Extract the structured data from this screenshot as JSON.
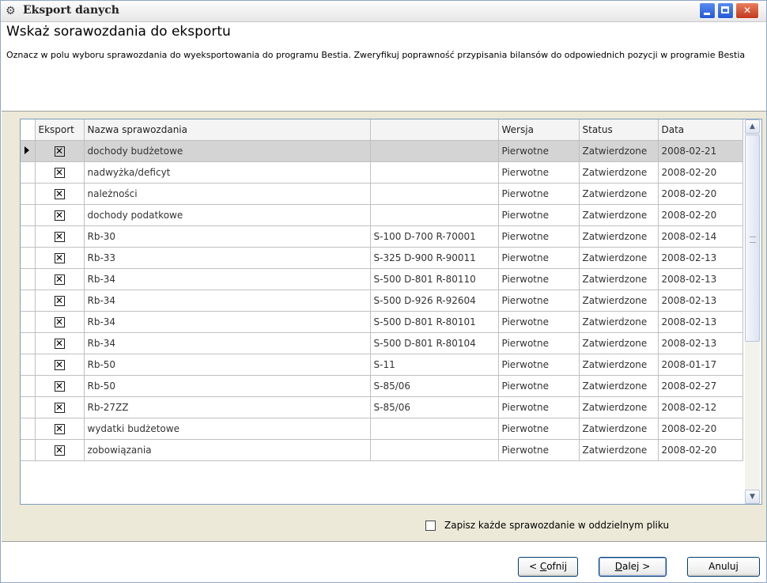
{
  "window": {
    "title": "Eksport danych",
    "icon": "export-icon",
    "controls": {
      "minimize": "minimize-icon",
      "maximize": "maximize-icon",
      "close": "close-icon"
    }
  },
  "header": {
    "heading": "Wskaż sorawozdania do eksportu",
    "description": "Oznacz w polu wyboru sprawozdania do wyeksportowania do programu Bestia. Zweryfikuj poprawność przypisania bilansów do odpowiednich pozycji w programie Bestia"
  },
  "grid": {
    "columns": [
      "Eksport",
      "Nazwa sprawozdania",
      "",
      "Wersja",
      "Status",
      "Data"
    ],
    "rows": [
      {
        "checked": "✕",
        "name": "dochody budżetowe",
        "code": "",
        "version": "Pierwotne",
        "status": "Zatwierdzone",
        "date": "2008-02-21"
      },
      {
        "checked": "✕",
        "name": "nadwyżka/deficyt",
        "code": "",
        "version": "Pierwotne",
        "status": "Zatwierdzone",
        "date": "2008-02-20"
      },
      {
        "checked": "✕",
        "name": "należności",
        "code": "",
        "version": "Pierwotne",
        "status": "Zatwierdzone",
        "date": "2008-02-20"
      },
      {
        "checked": "✕",
        "name": "dochody podatkowe",
        "code": "",
        "version": "Pierwotne",
        "status": "Zatwierdzone",
        "date": "2008-02-20"
      },
      {
        "checked": "✕",
        "name": "Rb-30",
        "code": "S-100 D-700 R-70001",
        "version": "Pierwotne",
        "status": "Zatwierdzone",
        "date": "2008-02-14"
      },
      {
        "checked": "✕",
        "name": "Rb-33",
        "code": "S-325 D-900 R-90011",
        "version": "Pierwotne",
        "status": "Zatwierdzone",
        "date": "2008-02-13"
      },
      {
        "checked": "✕",
        "name": "Rb-34",
        "code": "S-500 D-801 R-80110",
        "version": "Pierwotne",
        "status": "Zatwierdzone",
        "date": "2008-02-13"
      },
      {
        "checked": "✕",
        "name": "Rb-34",
        "code": "S-500 D-926 R-92604",
        "version": "Pierwotne",
        "status": "Zatwierdzone",
        "date": "2008-02-13"
      },
      {
        "checked": "✕",
        "name": "Rb-34",
        "code": "S-500 D-801 R-80101",
        "version": "Pierwotne",
        "status": "Zatwierdzone",
        "date": "2008-02-13"
      },
      {
        "checked": "✕",
        "name": "Rb-34",
        "code": "S-500 D-801 R-80104",
        "version": "Pierwotne",
        "status": "Zatwierdzone",
        "date": "2008-02-13"
      },
      {
        "checked": "✕",
        "name": "Rb-50",
        "code": "S-11",
        "version": "Pierwotne",
        "status": "Zatwierdzone",
        "date": "2008-01-17"
      },
      {
        "checked": "✕",
        "name": "Rb-50",
        "code": "S-85/06",
        "version": "Pierwotne",
        "status": "Zatwierdzone",
        "date": "2008-02-27"
      },
      {
        "checked": "✕",
        "name": "Rb-27ZZ",
        "code": "S-85/06",
        "version": "Pierwotne",
        "status": "Zatwierdzone",
        "date": "2008-02-12"
      },
      {
        "checked": "✕",
        "name": "wydatki budżetowe",
        "code": "",
        "version": "Pierwotne",
        "status": "Zatwierdzone",
        "date": "2008-02-20"
      },
      {
        "checked": "✕",
        "name": "zobowiązania",
        "code": "",
        "version": "Pierwotne",
        "status": "Zatwierdzone",
        "date": "2008-02-20"
      }
    ]
  },
  "options": {
    "separate_file_label": "Zapisz każde sprawozdanie w oddzielnym pliku"
  },
  "buttons": {
    "back_prefix": "< ",
    "back_key": "C",
    "back_rest": "ofnij",
    "next_key": "D",
    "next_rest": "alej >",
    "cancel": "Anuluj"
  }
}
